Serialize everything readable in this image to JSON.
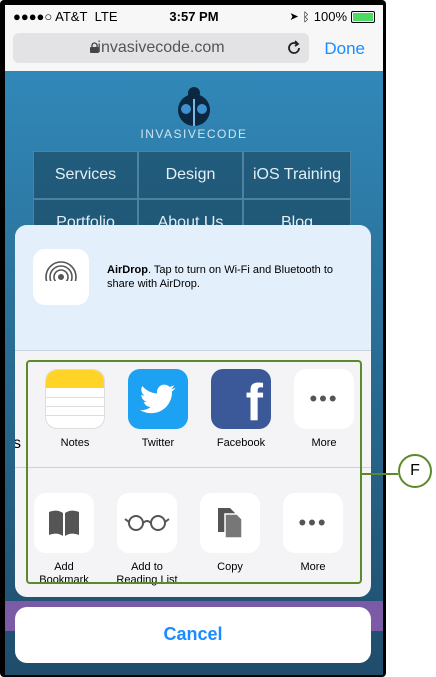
{
  "status": {
    "carrier": "●●●●○ AT&T",
    "network": "LTE",
    "time": "3:57 PM",
    "battery": "100%"
  },
  "browser": {
    "url": "invasivecode.com",
    "done_label": "Done"
  },
  "website": {
    "brand": "INVASIVECODE",
    "nav": [
      "Services",
      "Design",
      "iOS Training",
      "Portfolio",
      "About Us",
      "Blog"
    ]
  },
  "share_sheet": {
    "airdrop_title": "AirDrop",
    "airdrop_desc": ". Tap to turn on Wi-Fi and Bluetooth to share with AirDrop.",
    "peek_label": "s",
    "apps": [
      {
        "label": "Notes",
        "icon": "notes-icon"
      },
      {
        "label": "Twitter",
        "icon": "twitter-icon"
      },
      {
        "label": "Facebook",
        "icon": "facebook-icon"
      },
      {
        "label": "More",
        "icon": "more-icon"
      }
    ],
    "actions": [
      {
        "label": "Add Bookmark",
        "icon": "book-icon"
      },
      {
        "label": "Add to Reading List",
        "icon": "glasses-icon"
      },
      {
        "label": "Copy",
        "icon": "copy-icon"
      },
      {
        "label": "More",
        "icon": "more-icon"
      }
    ],
    "cancel_label": "Cancel"
  },
  "annotation": {
    "label": "F",
    "color": "#5c8a2a"
  },
  "colors": {
    "accent": "#1a8cff",
    "twitter": "#1da1f2",
    "facebook": "#3b5998"
  }
}
